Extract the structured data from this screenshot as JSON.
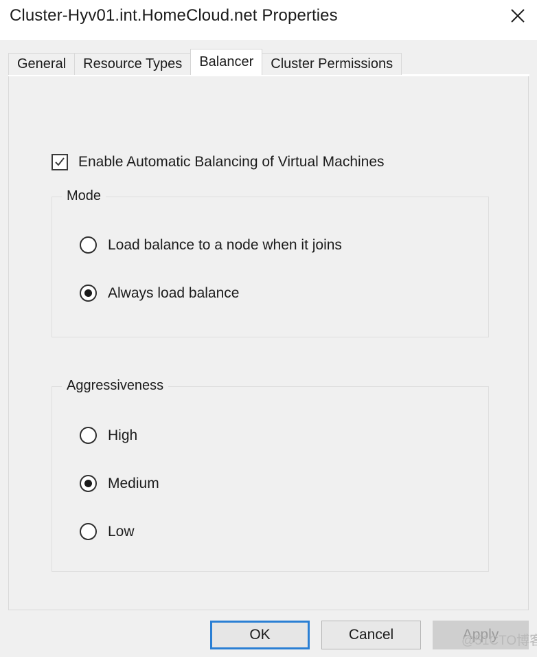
{
  "window": {
    "title": "Cluster-Hyv01.int.HomeCloud.net Properties",
    "close_icon": "close-icon"
  },
  "tabs": [
    {
      "label": "General",
      "active": false
    },
    {
      "label": "Resource Types",
      "active": false
    },
    {
      "label": "Balancer",
      "active": true
    },
    {
      "label": "Cluster Permissions",
      "active": false
    }
  ],
  "balancer": {
    "enable_checkbox": {
      "label": "Enable Automatic Balancing of Virtual Machines",
      "checked": true
    },
    "mode": {
      "title": "Mode",
      "options": [
        {
          "label": "Load balance to a node when it joins",
          "selected": false
        },
        {
          "label": "Always load balance",
          "selected": true
        }
      ]
    },
    "aggressiveness": {
      "title": "Aggressiveness",
      "options": [
        {
          "label": "High",
          "selected": false
        },
        {
          "label": "Medium",
          "selected": true
        },
        {
          "label": "Low",
          "selected": false
        }
      ]
    }
  },
  "footer": {
    "ok_label": "OK",
    "cancel_label": "Cancel",
    "apply_label": "Apply",
    "apply_disabled": true
  },
  "watermark": {
    "text": "@51CTO博客"
  },
  "colors": {
    "dialog_background": "#f0f0f0",
    "titlebar_background": "#ffffff",
    "accent_focus": "#2a7fd4",
    "text": "#1b1b1b",
    "disabled_text": "#9b9b9b",
    "border": "#d9d9d9"
  }
}
